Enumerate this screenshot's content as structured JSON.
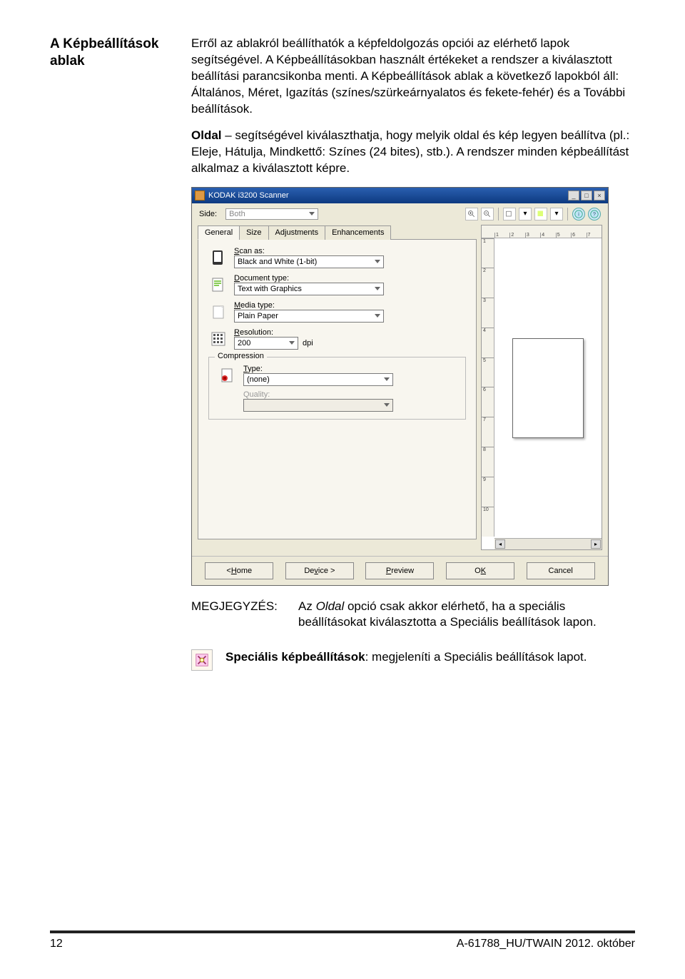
{
  "section_title": "A Képbeállítások ablak",
  "para1": "Erről az ablakról beállíthatók a képfeldolgozás opciói az elérhető lapok segítségével. A Képbeállításokban használt értékeket a rendszer a kiválasztott beállítási parancsikonba menti. A Képbeállítások ablak a következő lapokból áll: Általános, Méret, Igazítás (színes/szürkeárnyalatos és fekete-fehér) és a További beállítások.",
  "para2_pre": "Oldal",
  "para2_rest": " – segítségével kiválaszthatja, hogy melyik oldal és kép legyen beállítva (pl.: Eleje, Hátulja, Mindkettő: Színes (24 bites), stb.). A rendszer minden képbeállítást alkalmaz a kiválasztott képre.",
  "dialog": {
    "title": "KODAK i3200 Scanner",
    "side_label": "Side:",
    "side_value": "Both",
    "tabs": [
      "General",
      "Size",
      "Adjustments",
      "Enhancements"
    ],
    "scan_as_label_pre": "S",
    "scan_as_label_mid": "can as:",
    "scan_as_value": "Black and White (1-bit)",
    "doctype_label_pre": "D",
    "doctype_label_mid": "ocument type:",
    "doctype_value": "Text with Graphics",
    "media_label_pre": "M",
    "media_label_mid": "edia type:",
    "media_value": "Plain Paper",
    "res_label_pre": "R",
    "res_label_mid": "esolution:",
    "res_value": "200",
    "res_unit": "dpi",
    "comp_label_pre": "C",
    "comp_label_mid": "ompression",
    "type_label_pre": "T",
    "type_label_mid": "ype:",
    "type_value": "(none)",
    "quality_label": "Quality:",
    "ruler_h": [
      "1",
      "2",
      "3",
      "4",
      "5",
      "6",
      "7"
    ],
    "ruler_v": [
      "1",
      "2",
      "3",
      "4",
      "5",
      "6",
      "7",
      "8",
      "9",
      "10"
    ],
    "buttons": {
      "home_pre": "< ",
      "home_u": "H",
      "home_post": "ome",
      "device_pre": "De",
      "device_u": "v",
      "device_post": "ice >",
      "preview_pre": "",
      "preview_u": "P",
      "preview_post": "review",
      "ok_pre": "O",
      "ok_u": "K",
      "ok_post": "",
      "cancel_pre": "",
      "cancel_u": "",
      "cancel_post": "Cancel"
    }
  },
  "note_label": "MEGJEGYZÉS:",
  "note_pre": "Az ",
  "note_em": "Oldal",
  "note_post": " opció csak akkor elérhető, ha a speciális beállításokat kiválasztotta a Speciális beállítások lapon.",
  "adv_bold": "Speciális képbeállítások",
  "adv_rest": ": megjeleníti a Speciális beállítások lapot.",
  "footer_left": "12",
  "footer_right": "A-61788_HU/TWAIN  2012. október"
}
